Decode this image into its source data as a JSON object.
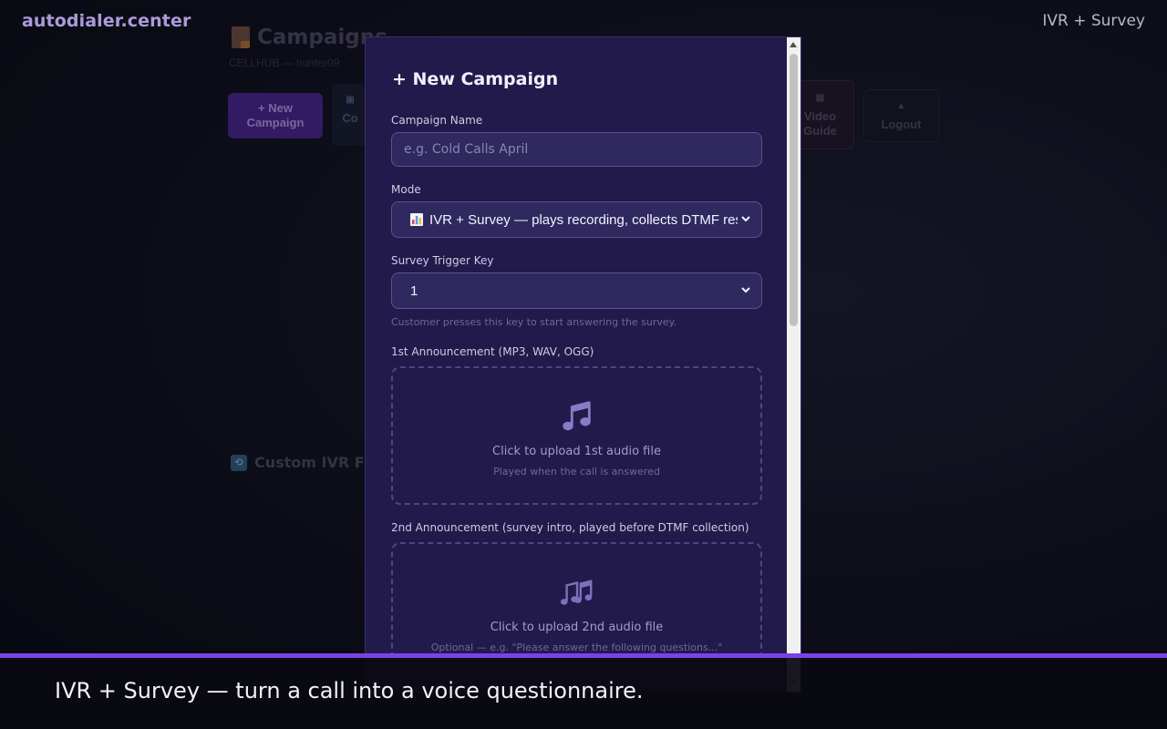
{
  "header": {
    "brand": "autodialer.center",
    "mode_label": "IVR + Survey"
  },
  "background_page": {
    "title": "Campaigns",
    "subtitle": "CELLHUB — hunter09",
    "buttons": {
      "new_campaign": "+ New Campaign",
      "second_partial": "Co",
      "video_guide": "Video Guide",
      "logout": "Logout"
    },
    "section_heading": "Custom IVR Flo"
  },
  "modal": {
    "title": "+ New Campaign",
    "campaign_name": {
      "label": "Campaign Name",
      "placeholder": "e.g. Cold Calls April",
      "value": ""
    },
    "mode": {
      "label": "Mode",
      "selected": "IVR + Survey — plays recording, collects DTMF responses"
    },
    "survey_trigger_key": {
      "label": "Survey Trigger Key",
      "selected": "1",
      "hint": "Customer presses this key to start answering the survey."
    },
    "announcement_1": {
      "label": "1st Announcement (MP3, WAV, OGG)",
      "icon": "music-note-icon",
      "cta": "Click to upload 1st audio file",
      "sub": "Played when the call is answered"
    },
    "announcement_2": {
      "label": "2nd Announcement (survey intro, played before DTMF collection)",
      "icon": "music-notes-icon",
      "cta": "Click to upload 2nd audio file",
      "sub": "Optional — e.g. \"Please answer the following questions...\""
    }
  },
  "caption": {
    "text": "IVR + Survey — turn a call into a voice questionnaire."
  },
  "colors": {
    "accent": "#7b42e6",
    "modal_bg": "#221a4a",
    "brand": "#c8b6ff"
  }
}
